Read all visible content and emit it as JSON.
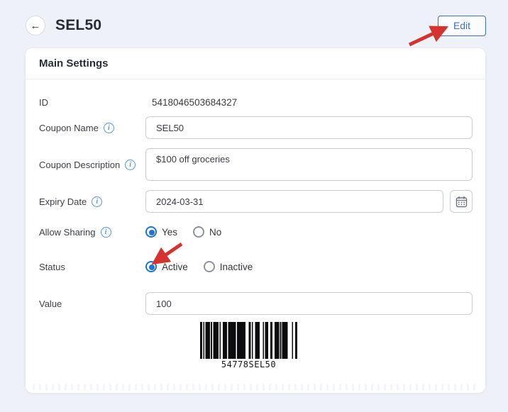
{
  "header": {
    "title": "SEL50",
    "back_icon": "arrow-left",
    "edit_label": "Edit"
  },
  "card": {
    "title": "Main Settings",
    "rows": {
      "id": {
        "label": "ID",
        "value": "5418046503684327"
      },
      "coupon_name": {
        "label": "Coupon Name",
        "value": "SEL50",
        "info_icon": "info-circle"
      },
      "coupon_description": {
        "label": "Coupon Description",
        "value": "$100 off groceries",
        "info_icon": "info-circle"
      },
      "expiry_date": {
        "label": "Expiry Date",
        "value": "2024-03-31",
        "info_icon": "info-circle",
        "addon_icon": "calendar"
      },
      "allow_sharing": {
        "label": "Allow Sharing",
        "info_icon": "info-circle",
        "options": [
          "Yes",
          "No"
        ],
        "selected": "Yes"
      },
      "status": {
        "label": "Status",
        "options": [
          "Active",
          "Inactive"
        ],
        "selected": "Active"
      },
      "value": {
        "label": "Value",
        "value": "100"
      }
    },
    "barcode": {
      "value": "54778SEL50"
    }
  },
  "annotations": {
    "arrow_to_edit": "red arrow pointing at Edit button",
    "arrow_to_active": "red arrow pointing at Active radio"
  },
  "colors": {
    "page_background": "#eef2f8",
    "card_background": "#ffffff",
    "accent_blue": "#3e6fc0",
    "radio_blue": "#1c76d2",
    "info_blue": "#5596d8",
    "arrow_red": "#d63330",
    "input_border": "#c9ced6"
  }
}
